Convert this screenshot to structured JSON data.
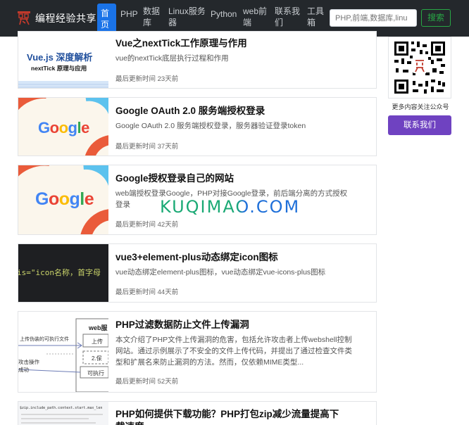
{
  "navbar": {
    "brand": "编程经验共享",
    "items": [
      {
        "label": "首\n页",
        "active": true
      },
      {
        "label": "PHP",
        "active": false
      },
      {
        "label": "数据\n库",
        "active": false
      },
      {
        "label": "Linux服务\n器",
        "active": false
      },
      {
        "label": "Python",
        "active": false
      },
      {
        "label": "web前\n端",
        "active": false
      },
      {
        "label": "联系我\n们",
        "active": false
      },
      {
        "label": "工具\n箱",
        "active": false
      }
    ],
    "search_placeholder": "PHP,前端,数据库,linu",
    "search_button": "搜索"
  },
  "articles": [
    {
      "title": "Vue之nextTick工作原理与作用",
      "desc": "vue的nextTick底层执行过程和作用",
      "meta": "最后更新时间 23天前",
      "thumb_title": "Vue.js 深度解析",
      "thumb_sub": "nextTick 原理与应用"
    },
    {
      "title": "Google OAuth 2.0 服务端授权登录",
      "desc": "Google OAuth 2.0 服务端授权登录，服务器验证登录token",
      "meta": "最后更新时间 37天前",
      "thumb_title": "Google"
    },
    {
      "title": "Google授权登录自己的网站",
      "desc": "web端授权登录Google，PHP对接Google登录，前后端分离的方式授权登录",
      "meta": "最后更新时间 42天前",
      "thumb_title": "Google"
    },
    {
      "title": "vue3+element-plus动态绑定icon图标",
      "desc": "vue动态绑定element-plus图标，vue动态绑定vue-icons-plus图标",
      "meta": "最后更新时间 44天前",
      "thumb_code": "is=\"icon名称，首字母"
    },
    {
      "title": "PHP过滤数据防止文件上传漏洞",
      "desc": "本文介绍了PHP文件上传漏洞的危害，包括允许攻击者上传webshell控制网站。通过示例展示了不安全的文件上传代码，并提出了通过检查文件类型和扩展名来防止漏洞的方法。然而，仅依赖MIME类型...",
      "meta": "最后更新时间 52天前",
      "thumb_labels": [
        "web服",
        "上传伪装的可执行文件",
        "上传",
        "攻击操作",
        "成功",
        "2.保",
        "可执行"
      ]
    },
    {
      "title": "PHP如何提供下载功能？PHP打包zip减少流量提高下载速度",
      "desc": "",
      "meta": "",
      "thumb_code": "$zip.include_path.context.start.max_len"
    }
  ],
  "watermark": "KUQIMAO.COM",
  "sidebar": {
    "qr_caption": "更多内容关注公众号",
    "contact_button": "联系我们"
  },
  "colors": {
    "navbar_bg": "#24282c",
    "nav_active": "#1a73e8",
    "search_button": "#28a745",
    "contact_button": "#6f42c1"
  }
}
